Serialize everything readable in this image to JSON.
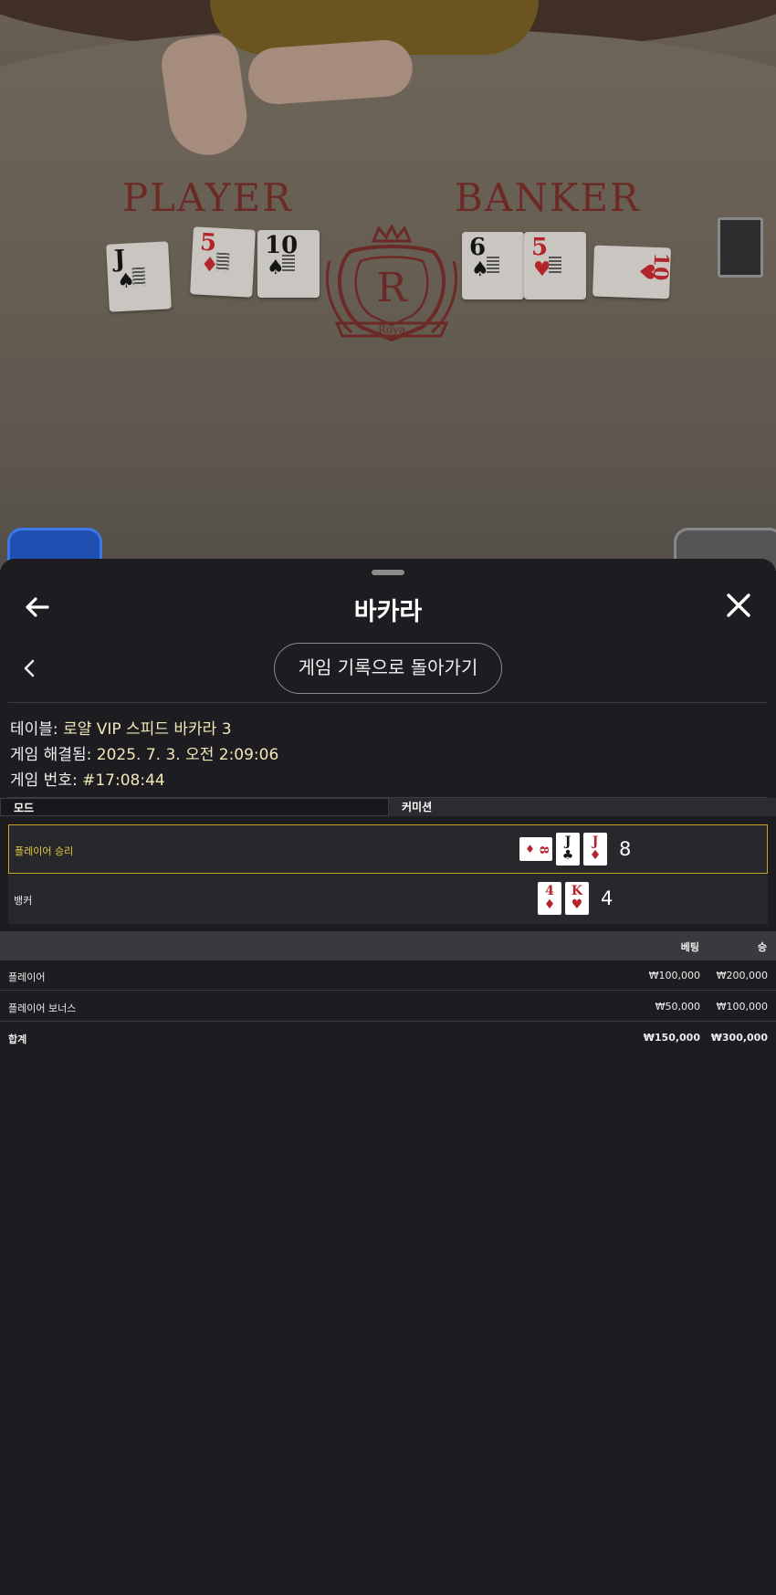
{
  "video": {
    "felt_player": "PLAYER",
    "felt_banker": "BANKER",
    "crest_letter": "R",
    "crest_ribbon": "Roya",
    "player_cards": [
      {
        "rank": "J",
        "suit": "♠",
        "color": "#141414"
      },
      {
        "rank": "5",
        "suit": "♦",
        "color": "#b3252a"
      },
      {
        "rank": "10",
        "suit": "♠",
        "color": "#141414"
      }
    ],
    "banker_cards": [
      {
        "rank": "6",
        "suit": "♠",
        "color": "#141414"
      },
      {
        "rank": "5",
        "suit": "♥",
        "color": "#b3252a"
      },
      {
        "rank": "10",
        "suit": "♥",
        "color": "#b3252a"
      }
    ]
  },
  "header": {
    "title": "바카라",
    "back_icon": "arrow-left-icon",
    "close_icon": "close-icon"
  },
  "history_button": "게임 기록으로 돌아가기",
  "info": {
    "table_key": "테이블: ",
    "table_value": "로얄 VIP 스피드 바카라 3",
    "resolved_key": "게임 해결됨: ",
    "resolved_value": "2025. 7. 3. 오전 2:09:06",
    "game_no_key": "게임 번호: ",
    "game_no_value": "#17:08:44"
  },
  "tabs": [
    "모드",
    "커미션"
  ],
  "results": {
    "player": {
      "label": "플레이어 승리",
      "score": "8",
      "cards": [
        {
          "rank": "8",
          "suit": "♦",
          "side": true
        },
        {
          "rank": "J",
          "suit": "♣",
          "side": false
        },
        {
          "rank": "J",
          "suit": "♦",
          "side": false
        }
      ]
    },
    "banker": {
      "label": "뱅커",
      "score": "4",
      "cards": [
        {
          "rank": "4",
          "suit": "♦",
          "side": false
        },
        {
          "rank": "K",
          "suit": "♥",
          "side": false
        }
      ]
    }
  },
  "bets": {
    "col_bet": "베팅",
    "col_win": "승",
    "rows": [
      {
        "name": "플레이어",
        "bet": "₩100,000",
        "win": "₩200,000"
      },
      {
        "name": "플레이어 보너스",
        "bet": "₩50,000",
        "win": "₩100,000"
      }
    ],
    "total": {
      "name": "합계",
      "bet": "₩150,000",
      "win": "₩300,000"
    }
  },
  "colors": {
    "win_border": "#c3a72a",
    "win_label": "#e5c741",
    "info_value": "#f2e7b8",
    "sheet_bg": "#1d1c20"
  }
}
